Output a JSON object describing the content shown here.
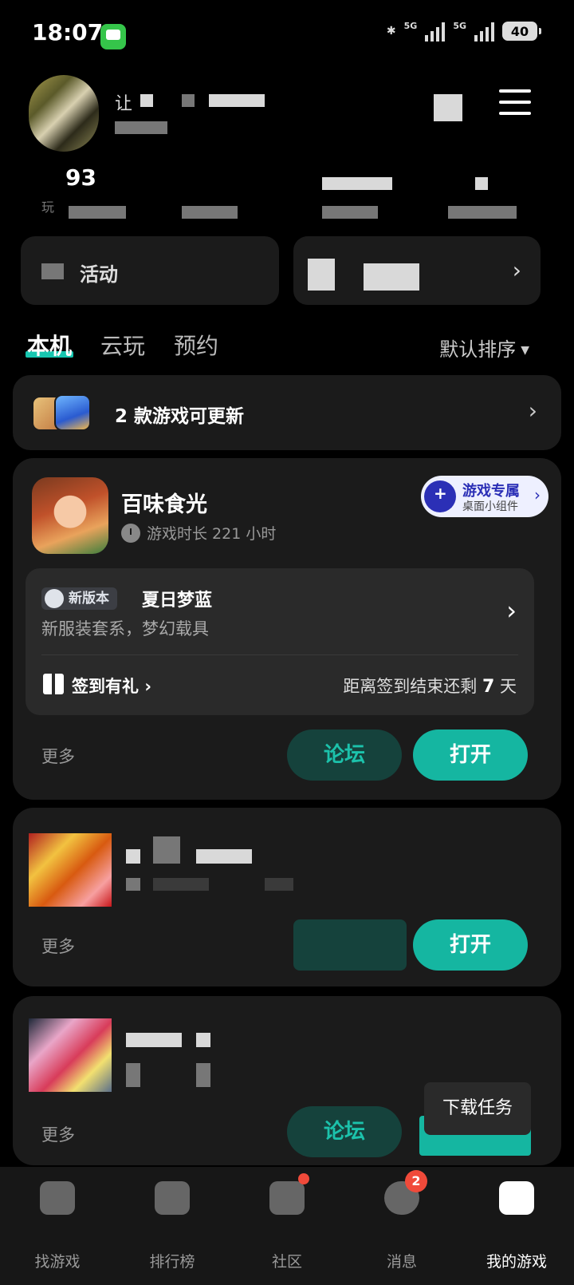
{
  "status_bar": {
    "time": "18:07",
    "signal_label": "5G",
    "battery": "40"
  },
  "profile": {
    "name_partial": "让",
    "stat_value": "93",
    "stat_label_partial": "玩"
  },
  "feature_cards": {
    "left_label": "活动"
  },
  "tabs": [
    {
      "label": "本机"
    },
    {
      "label": "云玩"
    },
    {
      "label": "预约"
    }
  ],
  "sort": {
    "label": "默认排序"
  },
  "update_bar": {
    "text": "2 款游戏可更新"
  },
  "game1": {
    "name": "百味食光",
    "play_time": "游戏时长 221 小时",
    "widget": {
      "title": "游戏专属",
      "subtitle": "桌面小组件"
    },
    "version_badge": "新版本",
    "version_title": "夏日梦蓝",
    "version_desc": "新服装套系，梦幻载具",
    "checkin_label": "签到有礼",
    "checkin_remain_prefix": "距离签到结束还剩",
    "checkin_days": "7",
    "checkin_unit": "天",
    "more": "更多",
    "forum_btn": "论坛",
    "open_btn": "打开"
  },
  "game2": {
    "more": "更多",
    "open_btn": "打开"
  },
  "game3": {
    "more": "更多",
    "forum_btn": "论坛"
  },
  "download_task": "下载任务",
  "bottom_nav": [
    {
      "label": "找游戏"
    },
    {
      "label": "排行榜"
    },
    {
      "label": "社区"
    },
    {
      "label": "消息",
      "badge": "2"
    },
    {
      "label": "我的游戏"
    }
  ]
}
